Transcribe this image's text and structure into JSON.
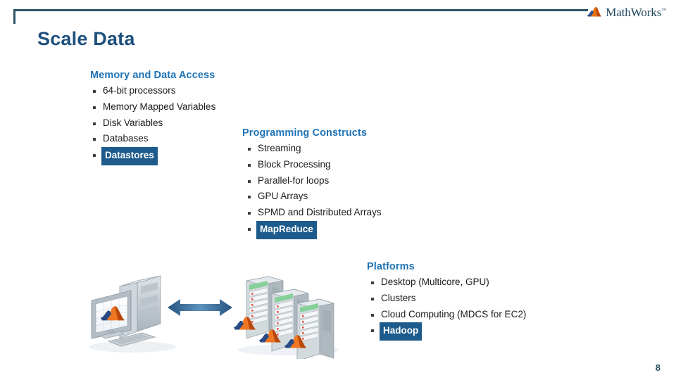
{
  "slide": {
    "title": "Scale Data",
    "page_number": "8",
    "accent_border_color": "#2b5566",
    "title_color": "#1d4f7c",
    "heading_color": "#1f73b5",
    "highlight_bg_color": "#1d5b8c",
    "highlight_text_color": "#ffffff"
  },
  "brand": {
    "name": "MathWorks",
    "trademark": "™",
    "logo_icon": "mathworks-membrane-icon"
  },
  "groups": [
    {
      "id": "memory",
      "heading": "Memory and Data Access",
      "items": [
        {
          "label": "64-bit processors",
          "highlighted": false
        },
        {
          "label": "Memory Mapped Variables",
          "highlighted": false
        },
        {
          "label": "Disk Variables",
          "highlighted": false
        },
        {
          "label": "Databases",
          "highlighted": false
        },
        {
          "label": "Datastores",
          "highlighted": true
        }
      ]
    },
    {
      "id": "programming",
      "heading": "Programming Constructs",
      "items": [
        {
          "label": "Streaming",
          "highlighted": false
        },
        {
          "label": "Block Processing",
          "highlighted": false
        },
        {
          "label": "Parallel-for loops",
          "highlighted": false
        },
        {
          "label": "GPU Arrays",
          "highlighted": false
        },
        {
          "label": "SPMD and Distributed Arrays",
          "highlighted": false
        },
        {
          "label": "MapReduce",
          "highlighted": true
        }
      ]
    },
    {
      "id": "platforms",
      "heading": "Platforms",
      "items": [
        {
          "label": "Desktop (Multicore, GPU)",
          "highlighted": false
        },
        {
          "label": "Clusters",
          "highlighted": false
        },
        {
          "label": "Cloud Computing (MDCS for EC2)",
          "highlighted": false
        },
        {
          "label": "Hadoop",
          "highlighted": true
        }
      ]
    }
  ],
  "artwork": {
    "desktop_icon": "desktop-computer-icon",
    "arrow_icon": "double-headed-arrow-icon",
    "servers_icon": "server-racks-icon",
    "arrow_color": "#3b6e9e"
  }
}
